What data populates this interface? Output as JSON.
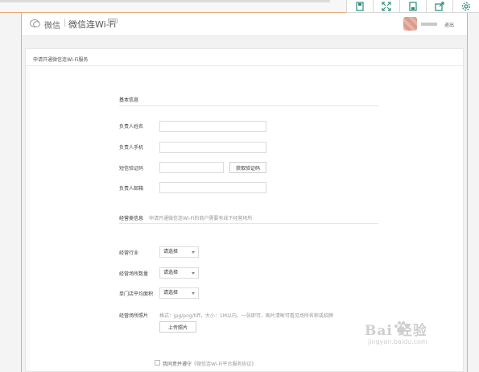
{
  "header": {
    "brand": "微信",
    "separator": "|",
    "product": "微信连Wi-Fi",
    "beta_badge": "beta",
    "logout": "退出"
  },
  "card": {
    "title": "申请开通微信连Wi-Fi服务"
  },
  "basic_info": {
    "title": "基本信息",
    "fields": [
      {
        "label": "负责人姓名",
        "value": ""
      },
      {
        "label": "负责人手机",
        "value": ""
      },
      {
        "label": "短信验证码",
        "value": ""
      },
      {
        "label": "负责人邮箱",
        "value": ""
      }
    ],
    "get_code_button": "获取验证码"
  },
  "business_info": {
    "title": "经营类信息",
    "desc": "申请开通微信连Wi-Fi的商户需要有线下经营场所",
    "fields": [
      {
        "label": "经营行业",
        "value": "请选择"
      },
      {
        "label": "经营场所数量",
        "value": "请选择"
      },
      {
        "label": "单门店平均面积",
        "value": "请选择"
      }
    ],
    "photo_label": "经营场所照片",
    "photo_hint": "格式：jpg/png/tiff，大小：1M以内。一张即可，图片清晰可看见场所名称或招牌",
    "upload_button": "上传照片"
  },
  "agreement": {
    "text": "我同意并遵守",
    "link": "《微信连Wi-Fi平台服务协议》"
  },
  "watermark": {
    "text": "Bai  经验",
    "url": "jingyan.baidu.com"
  },
  "toolbar_icons": [
    "save-icon",
    "fullscreen-icon",
    "save-as-icon",
    "share-icon",
    "settings-icon"
  ]
}
